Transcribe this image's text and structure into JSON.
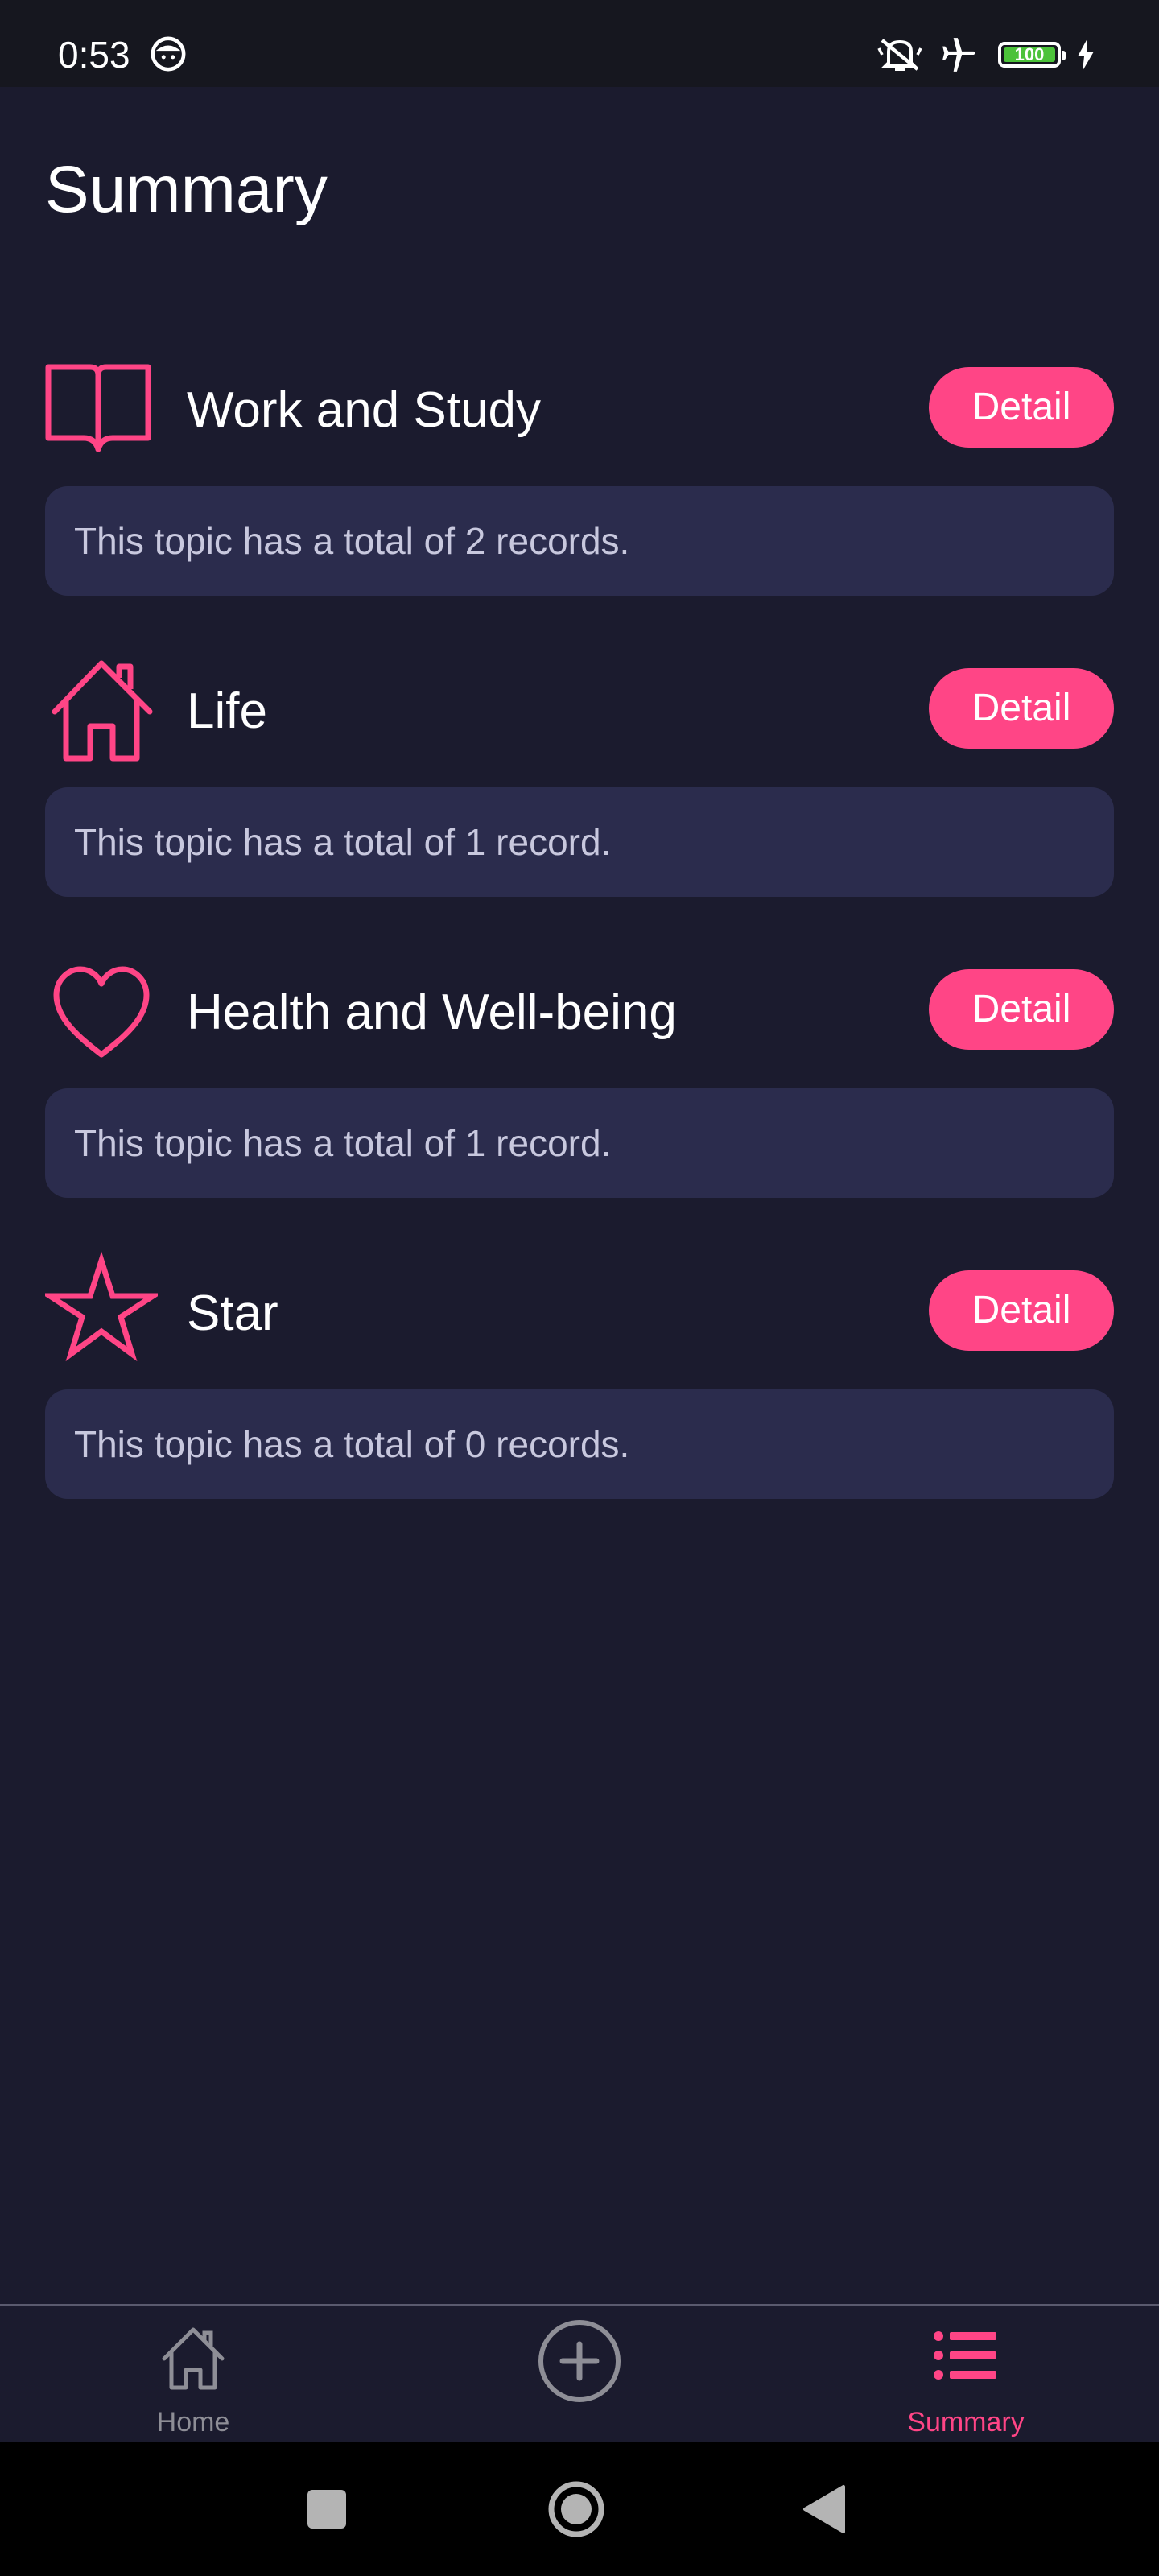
{
  "status_bar": {
    "time": "0:53",
    "battery_level": "100",
    "icons": [
      "face-icon",
      "mute-icon",
      "airplane-icon",
      "battery-icon",
      "charging-icon"
    ]
  },
  "page": {
    "title": "Summary"
  },
  "topics": [
    {
      "name": "Work and Study",
      "icon": "book-icon",
      "detail_label": "Detail",
      "count_text": "This topic has a total of 2 records."
    },
    {
      "name": "Life",
      "icon": "house-icon",
      "detail_label": "Detail",
      "count_text": "This topic has a total of 1 record."
    },
    {
      "name": "Health and Well-being",
      "icon": "heart-icon",
      "detail_label": "Detail",
      "count_text": "This topic has a total of 1 record."
    },
    {
      "name": "Star",
      "icon": "star-icon",
      "detail_label": "Detail",
      "count_text": "This topic has a total of 0 records."
    }
  ],
  "bottom_nav": {
    "items": [
      {
        "label": "Home",
        "icon": "home-icon",
        "active": false
      },
      {
        "label": "",
        "icon": "add-circle-icon",
        "active": false
      },
      {
        "label": "Summary",
        "icon": "list-icon",
        "active": true
      }
    ]
  },
  "colors": {
    "background": "#1b1b2e",
    "accent": "#ff4586",
    "card": "#2b2c4d",
    "inactive": "#8e8e96"
  }
}
